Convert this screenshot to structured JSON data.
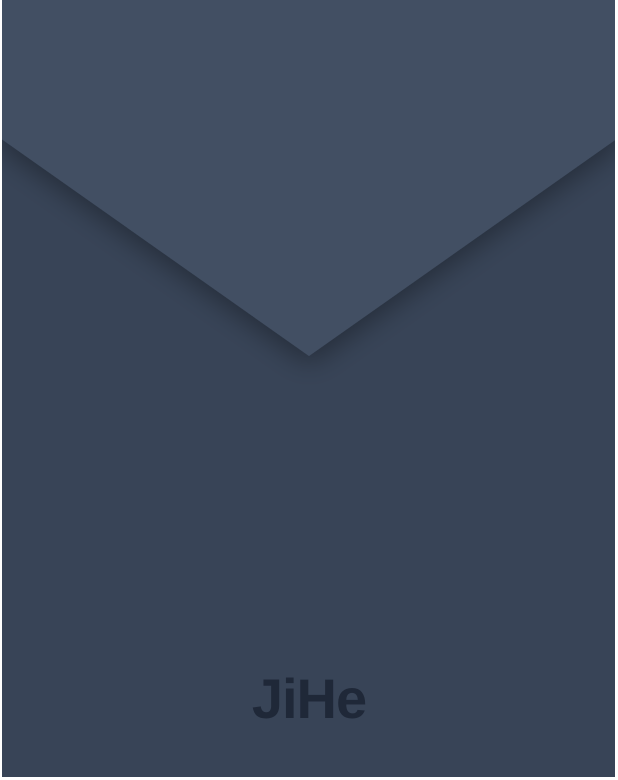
{
  "envelope": {
    "brand_logo_text": "JiHe",
    "colors": {
      "body": "#384457",
      "flap": "#424f63",
      "logo": "#1f2838",
      "frame": "#ffffff"
    }
  }
}
